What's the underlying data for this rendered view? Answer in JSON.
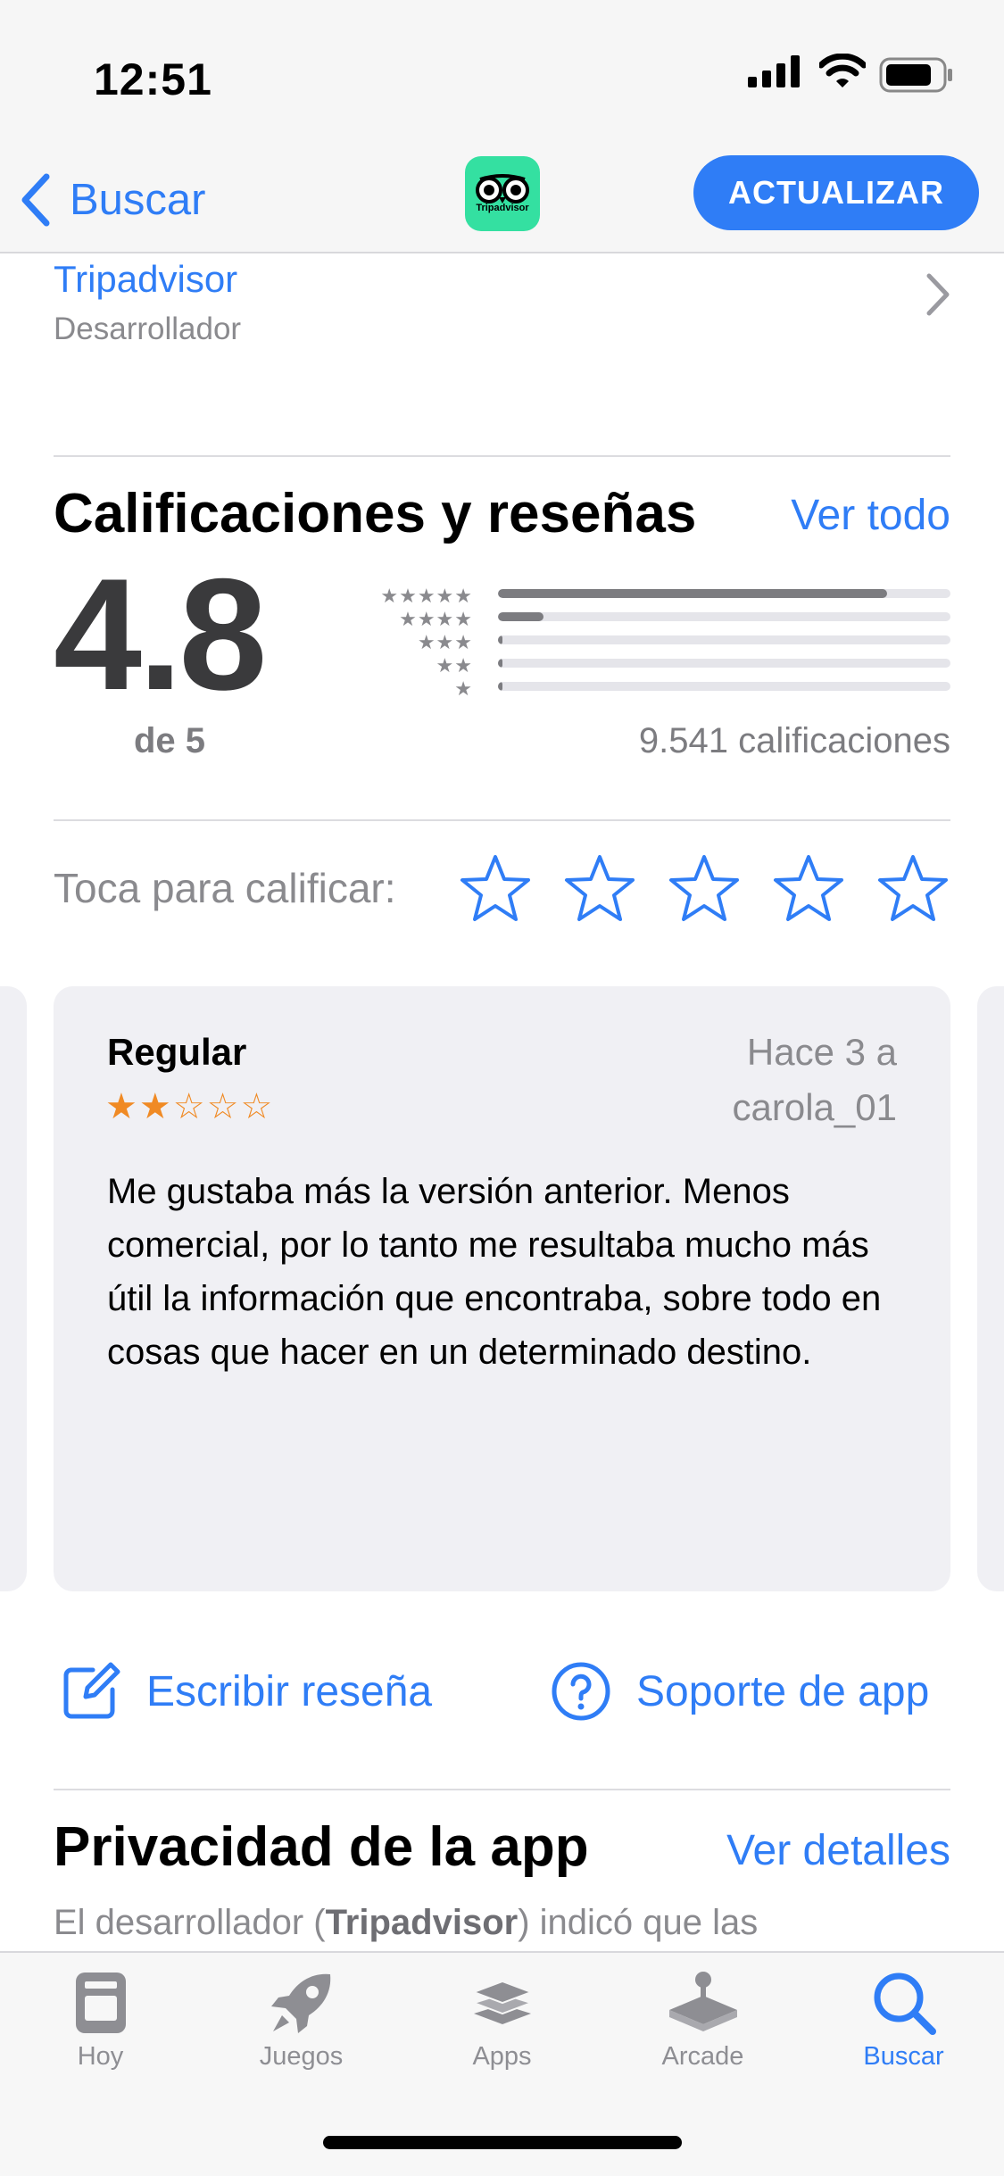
{
  "status_bar": {
    "time": "12:51"
  },
  "nav": {
    "back_label": "Buscar",
    "app_icon_label": "Tripadvisor",
    "update_label": "ACTUALIZAR"
  },
  "developer": {
    "name": "Tripadvisor",
    "caption": "Desarrollador"
  },
  "ratings": {
    "title": "Calificaciones y reseñas",
    "see_all": "Ver todo",
    "average": "4.8",
    "out_of": "de 5",
    "count_label": "9.541 calificaciones",
    "distribution": [
      {
        "stars": "★★★★★",
        "fraction": 0.86
      },
      {
        "stars": "★★★★",
        "fraction": 0.1
      },
      {
        "stars": "★★★",
        "fraction": 0.01
      },
      {
        "stars": "★★",
        "fraction": 0.01
      },
      {
        "stars": "★",
        "fraction": 0.01
      }
    ]
  },
  "tap_to_rate": {
    "label": "Toca para calificar:"
  },
  "review": {
    "title": "Regular",
    "rating": 2,
    "stars": "★★☆☆☆",
    "date": "Hace 3 a",
    "author": "carola_01",
    "body": "Me gustaba más la versión anterior. Menos comercial, por lo tanto me resultaba mucho más útil la información que encontraba, sobre todo en cosas que hacer en un determinado destino."
  },
  "actions": {
    "write_review": "Escribir reseña",
    "app_support": "Soporte de app"
  },
  "privacy": {
    "title": "Privacidad de la app",
    "details_link": "Ver detalles",
    "desc_pre": "El desarrollador (",
    "desc_bold": "Tripadvisor",
    "desc_post": ") indicó que las"
  },
  "tabs": [
    {
      "label": "Hoy",
      "icon": "today-icon"
    },
    {
      "label": "Juegos",
      "icon": "rocket-icon"
    },
    {
      "label": "Apps",
      "icon": "apps-stack-icon"
    },
    {
      "label": "Arcade",
      "icon": "joystick-icon"
    },
    {
      "label": "Buscar",
      "icon": "search-icon",
      "active": true
    }
  ],
  "colors": {
    "accent": "#2f7df6",
    "review_star": "#f08a24",
    "tripadvisor_green": "#34e0a1"
  }
}
